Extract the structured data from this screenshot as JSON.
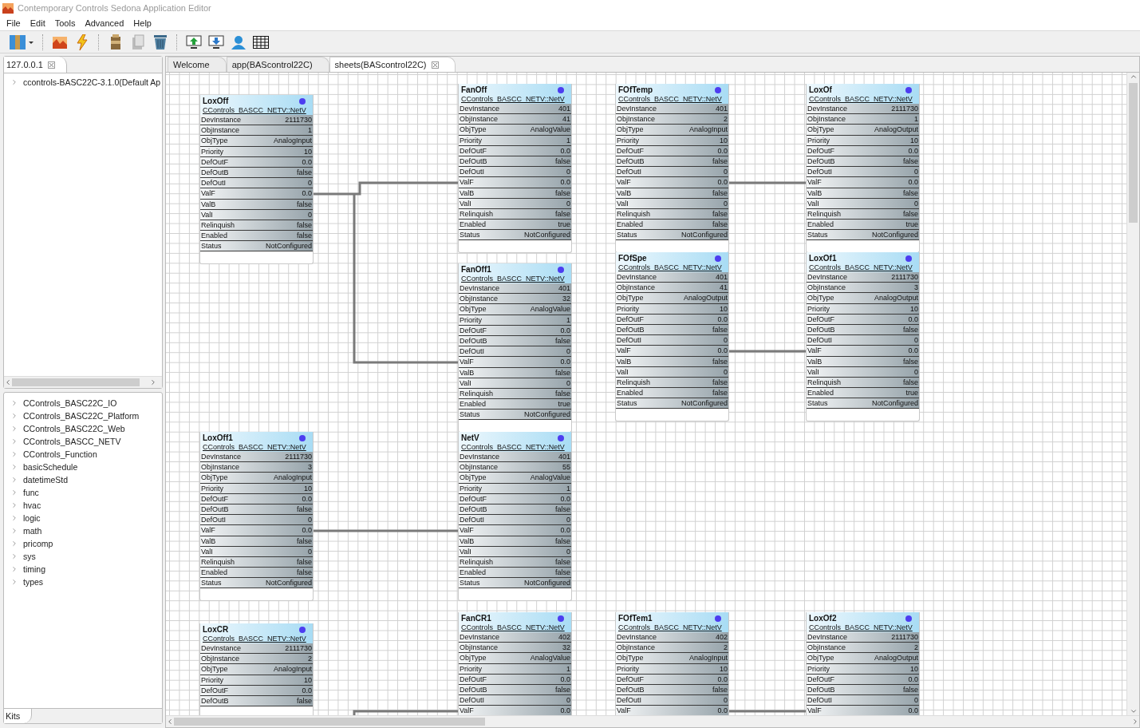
{
  "window": {
    "title": "Contemporary Controls Sedona Application Editor"
  },
  "menu": [
    "File",
    "Edit",
    "Tools",
    "Advanced",
    "Help"
  ],
  "device_panel": {
    "tab": "127.0.0.1",
    "tree": [
      {
        "label": "ccontrols-BASC22C-3.1.0(Default Ap",
        "expanded": false
      }
    ]
  },
  "kits_panel": {
    "tab": "Kits",
    "items": [
      {
        "label": "CControls_BASC22C_IO",
        "expanded": false
      },
      {
        "label": "CControls_BASC22C_Platform",
        "expanded": false
      },
      {
        "label": "CControls_BASC22C_Web",
        "expanded": false
      },
      {
        "label": "CControls_BASCC_NETV",
        "expanded": false
      },
      {
        "label": "CControls_Function",
        "expanded": false
      },
      {
        "label": "basicSchedule",
        "expanded": false
      },
      {
        "label": "datetimeStd",
        "expanded": false
      },
      {
        "label": "func",
        "expanded": false
      },
      {
        "label": "hvac",
        "expanded": false
      },
      {
        "label": "logic",
        "expanded": false
      },
      {
        "label": "math",
        "expanded": false
      },
      {
        "label": "pricomp",
        "expanded": false
      },
      {
        "label": "sys",
        "expanded": false
      },
      {
        "label": "timing",
        "expanded": false
      },
      {
        "label": "types",
        "expanded": false
      }
    ]
  },
  "editor_tabs": [
    {
      "label": "Welcome",
      "selected": false,
      "closable": false
    },
    {
      "label": "app(BAScontrol22C)",
      "selected": false,
      "closable": false
    },
    {
      "label": "sheets(BAScontrol22C)",
      "selected": true,
      "closable": true
    }
  ],
  "blocks": [
    {
      "title": "LoxOff",
      "type": "CControls_BASCC_NETV::NetV",
      "rows": [
        [
          "DevInstance",
          "2111730"
        ],
        [
          "ObjInstance",
          "1"
        ],
        [
          "ObjType",
          "AnalogInput"
        ],
        [
          "Priority",
          "10"
        ],
        [
          "DefOutF",
          "0.0"
        ],
        [
          "DefOutB",
          "false"
        ],
        [
          "DefOutI",
          "0"
        ],
        [
          "ValF",
          "0.0"
        ],
        [
          "ValB",
          "false"
        ],
        [
          "ValI",
          "0"
        ],
        [
          "Relinquish",
          "false"
        ],
        [
          "Enabled",
          "false"
        ],
        [
          "Status",
          "NotConfigured"
        ]
      ]
    },
    {
      "title": "FanOff",
      "type": "CControls_BASCC_NETV::NetV",
      "rows": [
        [
          "DevInstance",
          "401"
        ],
        [
          "ObjInstance",
          "41"
        ],
        [
          "ObjType",
          "AnalogValue"
        ],
        [
          "Priority",
          "1"
        ],
        [
          "DefOutF",
          "0.0"
        ],
        [
          "DefOutB",
          "false"
        ],
        [
          "DefOutI",
          "0"
        ],
        [
          "ValF",
          "0.0"
        ],
        [
          "ValB",
          "false"
        ],
        [
          "ValI",
          "0"
        ],
        [
          "Relinquish",
          "false"
        ],
        [
          "Enabled",
          "true"
        ],
        [
          "Status",
          "NotConfigured"
        ]
      ]
    },
    {
      "title": "FOfTemp",
      "type": "CControls_BASCC_NETV::NetV",
      "rows": [
        [
          "DevInstance",
          "401"
        ],
        [
          "ObjInstance",
          "2"
        ],
        [
          "ObjType",
          "AnalogInput"
        ],
        [
          "Priority",
          "10"
        ],
        [
          "DefOutF",
          "0.0"
        ],
        [
          "DefOutB",
          "false"
        ],
        [
          "DefOutI",
          "0"
        ],
        [
          "ValF",
          "0.0"
        ],
        [
          "ValB",
          "false"
        ],
        [
          "ValI",
          "0"
        ],
        [
          "Relinquish",
          "false"
        ],
        [
          "Enabled",
          "false"
        ],
        [
          "Status",
          "NotConfigured"
        ]
      ]
    },
    {
      "title": "LoxOf",
      "type": "CControls_BASCC_NETV::NetV",
      "rows": [
        [
          "DevInstance",
          "2111730"
        ],
        [
          "ObjInstance",
          "1"
        ],
        [
          "ObjType",
          "AnalogOutput"
        ],
        [
          "Priority",
          "10"
        ],
        [
          "DefOutF",
          "0.0"
        ],
        [
          "DefOutB",
          "false"
        ],
        [
          "DefOutI",
          "0"
        ],
        [
          "ValF",
          "0.0"
        ],
        [
          "ValB",
          "false"
        ],
        [
          "ValI",
          "0"
        ],
        [
          "Relinquish",
          "false"
        ],
        [
          "Enabled",
          "true"
        ],
        [
          "Status",
          "NotConfigured"
        ]
      ]
    },
    {
      "title": "FanOff1",
      "type": "CControls_BASCC_NETV::NetV",
      "rows": [
        [
          "DevInstance",
          "401"
        ],
        [
          "ObjInstance",
          "32"
        ],
        [
          "ObjType",
          "AnalogValue"
        ],
        [
          "Priority",
          "1"
        ],
        [
          "DefOutF",
          "0.0"
        ],
        [
          "DefOutB",
          "false"
        ],
        [
          "DefOutI",
          "0"
        ],
        [
          "ValF",
          "0.0"
        ],
        [
          "ValB",
          "false"
        ],
        [
          "ValI",
          "0"
        ],
        [
          "Relinquish",
          "false"
        ],
        [
          "Enabled",
          "true"
        ],
        [
          "Status",
          "NotConfigured"
        ]
      ]
    },
    {
      "title": "FOfSpe",
      "type": "CControls_BASCC_NETV::NetV",
      "rows": [
        [
          "DevInstance",
          "401"
        ],
        [
          "ObjInstance",
          "41"
        ],
        [
          "ObjType",
          "AnalogOutput"
        ],
        [
          "Priority",
          "10"
        ],
        [
          "DefOutF",
          "0.0"
        ],
        [
          "DefOutB",
          "false"
        ],
        [
          "DefOutI",
          "0"
        ],
        [
          "ValF",
          "0.0"
        ],
        [
          "ValB",
          "false"
        ],
        [
          "ValI",
          "0"
        ],
        [
          "Relinquish",
          "false"
        ],
        [
          "Enabled",
          "false"
        ],
        [
          "Status",
          "NotConfigured"
        ]
      ]
    },
    {
      "title": "LoxOf1",
      "type": "CControls_BASCC_NETV::NetV",
      "rows": [
        [
          "DevInstance",
          "2111730"
        ],
        [
          "ObjInstance",
          "3"
        ],
        [
          "ObjType",
          "AnalogOutput"
        ],
        [
          "Priority",
          "10"
        ],
        [
          "DefOutF",
          "0.0"
        ],
        [
          "DefOutB",
          "false"
        ],
        [
          "DefOutI",
          "0"
        ],
        [
          "ValF",
          "0.0"
        ],
        [
          "ValB",
          "false"
        ],
        [
          "ValI",
          "0"
        ],
        [
          "Relinquish",
          "false"
        ],
        [
          "Enabled",
          "true"
        ],
        [
          "Status",
          "NotConfigured"
        ]
      ]
    },
    {
      "title": "LoxOff1",
      "type": "CControls_BASCC_NETV::NetV",
      "rows": [
        [
          "DevInstance",
          "2111730"
        ],
        [
          "ObjInstance",
          "3"
        ],
        [
          "ObjType",
          "AnalogInput"
        ],
        [
          "Priority",
          "10"
        ],
        [
          "DefOutF",
          "0.0"
        ],
        [
          "DefOutB",
          "false"
        ],
        [
          "DefOutI",
          "0"
        ],
        [
          "ValF",
          "0.0"
        ],
        [
          "ValB",
          "false"
        ],
        [
          "ValI",
          "0"
        ],
        [
          "Relinquish",
          "false"
        ],
        [
          "Enabled",
          "false"
        ],
        [
          "Status",
          "NotConfigured"
        ]
      ]
    },
    {
      "title": "NetV",
      "type": "CControls_BASCC_NETV::NetV",
      "rows": [
        [
          "DevInstance",
          "401"
        ],
        [
          "ObjInstance",
          "55"
        ],
        [
          "ObjType",
          "AnalogValue"
        ],
        [
          "Priority",
          "1"
        ],
        [
          "DefOutF",
          "0.0"
        ],
        [
          "DefOutB",
          "false"
        ],
        [
          "DefOutI",
          "0"
        ],
        [
          "ValF",
          "0.0"
        ],
        [
          "ValB",
          "false"
        ],
        [
          "ValI",
          "0"
        ],
        [
          "Relinquish",
          "false"
        ],
        [
          "Enabled",
          "false"
        ],
        [
          "Status",
          "NotConfigured"
        ]
      ]
    },
    {
      "title": "LoxCR",
      "type": "CControls_BASCC_NETV::NetV",
      "rows": [
        [
          "DevInstance",
          "2111730"
        ],
        [
          "ObjInstance",
          "2"
        ],
        [
          "ObjType",
          "AnalogInput"
        ],
        [
          "Priority",
          "10"
        ],
        [
          "DefOutF",
          "0.0"
        ],
        [
          "DefOutB",
          "false"
        ]
      ]
    },
    {
      "title": "FanCR1",
      "type": "CControls_BASCC_NETV::NetV",
      "rows": [
        [
          "DevInstance",
          "402"
        ],
        [
          "ObjInstance",
          "32"
        ],
        [
          "ObjType",
          "AnalogValue"
        ],
        [
          "Priority",
          "1"
        ],
        [
          "DefOutF",
          "0.0"
        ],
        [
          "DefOutB",
          "false"
        ],
        [
          "DefOutI",
          "0"
        ],
        [
          "ValF",
          "0.0"
        ]
      ]
    },
    {
      "title": "FOfTem1",
      "type": "CControls_BASCC_NETV::NetV",
      "rows": [
        [
          "DevInstance",
          "402"
        ],
        [
          "ObjInstance",
          "2"
        ],
        [
          "ObjType",
          "AnalogInput"
        ],
        [
          "Priority",
          "10"
        ],
        [
          "DefOutF",
          "0.0"
        ],
        [
          "DefOutB",
          "false"
        ],
        [
          "DefOutI",
          "0"
        ],
        [
          "ValF",
          "0.0"
        ]
      ]
    },
    {
      "title": "LoxOf2",
      "type": "CControls_BASCC_NETV::NetV",
      "rows": [
        [
          "DevInstance",
          "2111730"
        ],
        [
          "ObjInstance",
          "2"
        ],
        [
          "ObjType",
          "AnalogOutput"
        ],
        [
          "Priority",
          "10"
        ],
        [
          "DefOutF",
          "0.0"
        ],
        [
          "DefOutB",
          "false"
        ],
        [
          "DefOutI",
          "0"
        ],
        [
          "ValF",
          "0.0"
        ]
      ]
    }
  ]
}
